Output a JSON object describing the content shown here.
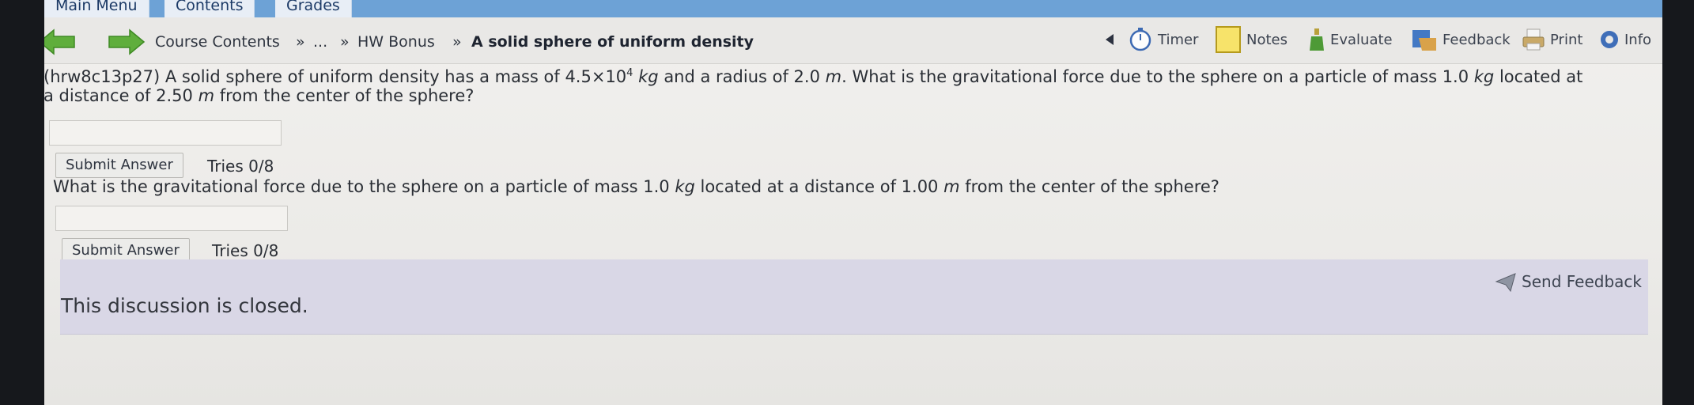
{
  "menu": {
    "tabs": [
      {
        "label": "Main Menu"
      },
      {
        "label": "Contents"
      },
      {
        "label": "Grades"
      }
    ]
  },
  "breadcrumb": {
    "items": [
      "Course Contents",
      "»",
      "...",
      "»",
      "HW Bonus",
      "»",
      "A solid sphere of uniform density"
    ]
  },
  "tools": {
    "timer": "Timer",
    "notes": "Notes",
    "evaluate": "Evaluate",
    "feedback": "Feedback",
    "print": "Print",
    "info": "Info"
  },
  "question1": {
    "id_prefix": "(hrw8c13p27) A solid sphere of uniform density has a mass of 4.5×10",
    "exponent": "4",
    "unit_kg": "kg",
    "mid": " and a radius of 2.0 ",
    "unit_m": "m",
    "rest": ". What is the gravitational force due to the sphere on a particle of mass 1.0 ",
    "unit_kg2": "kg",
    "end": " located at",
    "line2_start": "a distance of 2.50 ",
    "line2_unit": "m",
    "line2_end": " from the center of the sphere?",
    "answer_value": "",
    "submit_label": "Submit Answer",
    "tries": "Tries 0/8"
  },
  "question2": {
    "start": "What is the gravitational force due to the sphere on a particle of mass 1.0 ",
    "unit_kg": "kg",
    "mid": " located at a distance of 1.00 ",
    "unit_m": "m",
    "end": " from the center of the sphere?",
    "answer_value": "",
    "submit_label": "Submit Answer",
    "tries": "Tries 0/8"
  },
  "discussion": {
    "status": "This discussion is closed.",
    "send_feedback": "Send Feedback"
  },
  "colors": {
    "menubar": "#6da2d6",
    "nav_arrow": "#5fae3c",
    "discussion_bg": "#d9d7e6"
  },
  "icons": [
    "back-arrow-icon",
    "forward-arrow-icon",
    "timer-icon",
    "notes-icon",
    "evaluate-icon",
    "feedback-icon",
    "print-icon",
    "info-icon",
    "send-feedback-icon"
  ]
}
